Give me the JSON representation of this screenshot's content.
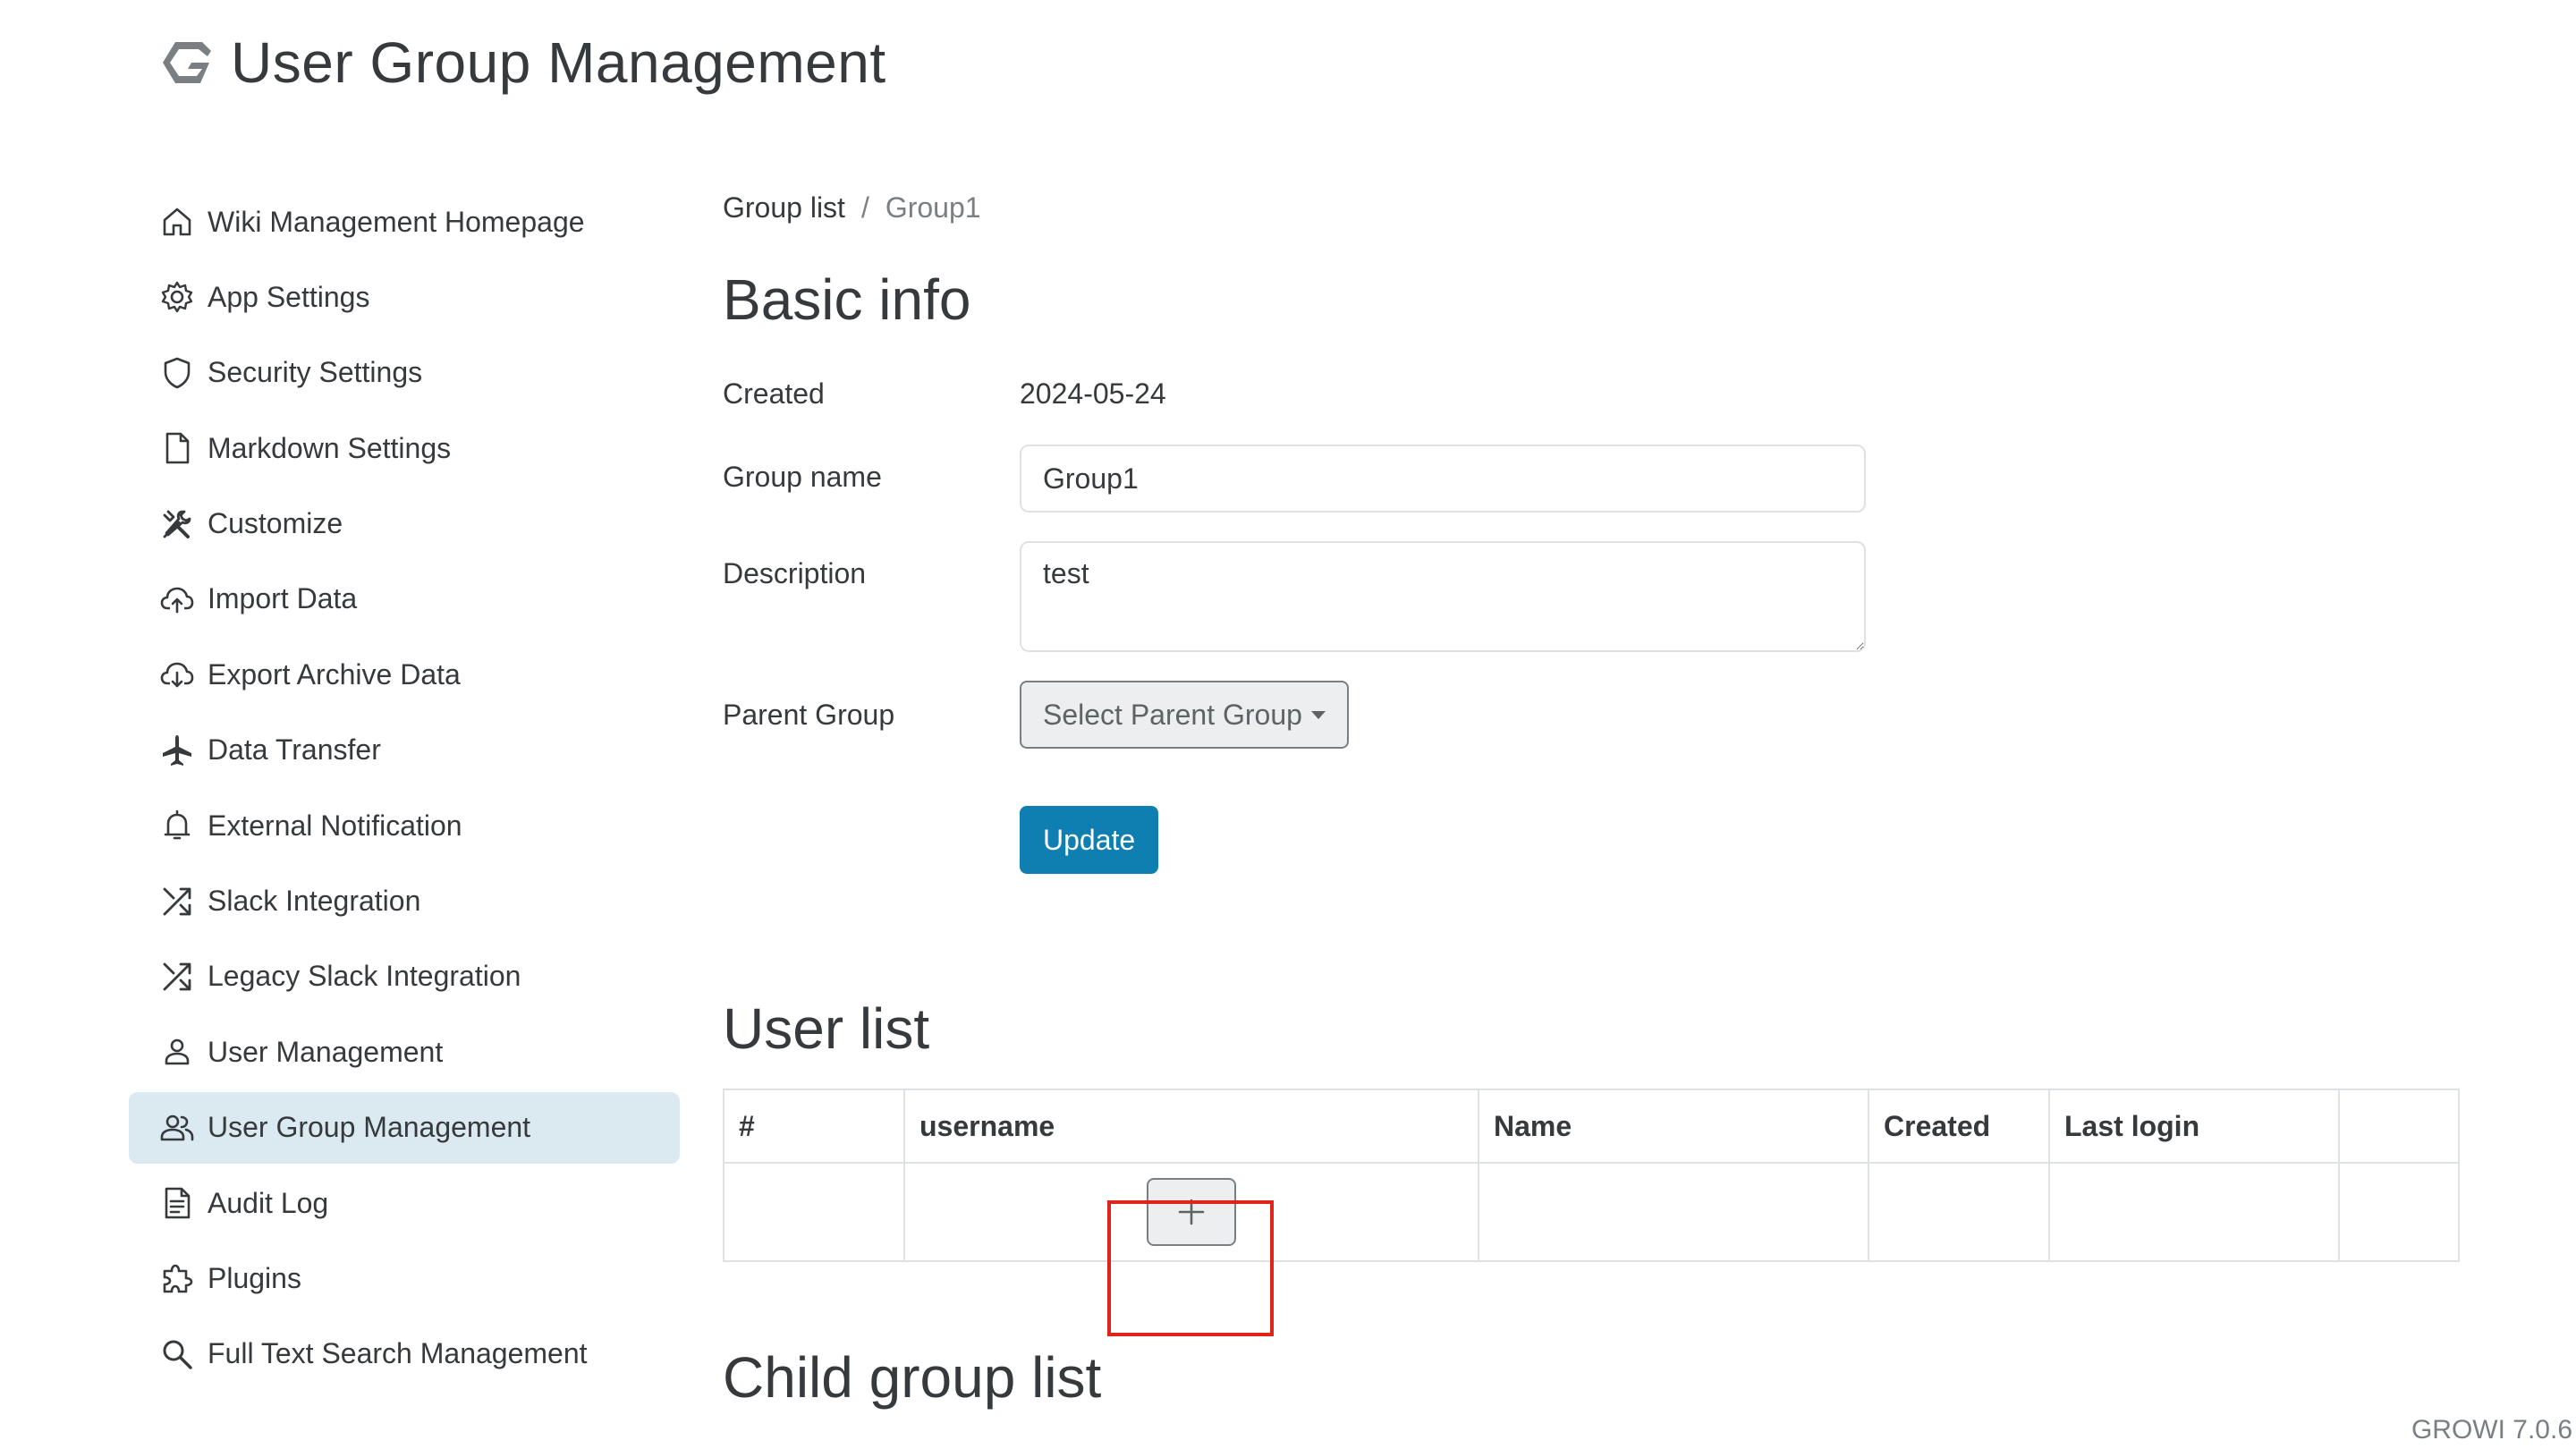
{
  "header": {
    "title": "User Group Management",
    "logo_icon": "growi-logo-icon"
  },
  "sidebar": {
    "items": [
      {
        "label": "Wiki Management Homepage",
        "icon": "home-icon",
        "active": false
      },
      {
        "label": "App Settings",
        "icon": "gear-icon",
        "active": false
      },
      {
        "label": "Security Settings",
        "icon": "shield-icon",
        "active": false
      },
      {
        "label": "Markdown Settings",
        "icon": "file-icon",
        "active": false
      },
      {
        "label": "Customize",
        "icon": "tools-icon",
        "active": false
      },
      {
        "label": "Import Data",
        "icon": "cloud-upload-icon",
        "active": false
      },
      {
        "label": "Export Archive Data",
        "icon": "cloud-download-icon",
        "active": false
      },
      {
        "label": "Data Transfer",
        "icon": "airplane-icon",
        "active": false
      },
      {
        "label": "External Notification",
        "icon": "bell-icon",
        "active": false
      },
      {
        "label": "Slack Integration",
        "icon": "shuffle-icon",
        "active": false
      },
      {
        "label": "Legacy Slack Integration",
        "icon": "shuffle-icon",
        "active": false
      },
      {
        "label": "User Management",
        "icon": "person-icon",
        "active": false
      },
      {
        "label": "User Group Management",
        "icon": "group-icon",
        "active": true
      },
      {
        "label": "Audit Log",
        "icon": "document-icon",
        "active": false
      },
      {
        "label": "Plugins",
        "icon": "puzzle-icon",
        "active": false
      },
      {
        "label": "Full Text Search Management",
        "icon": "search-icon",
        "active": false
      }
    ]
  },
  "breadcrumb": {
    "link": "Group list",
    "separator": "/",
    "current": "Group1"
  },
  "basic_info": {
    "title": "Basic info",
    "created_label": "Created",
    "created_value": "2024-05-24",
    "group_name_label": "Group name",
    "group_name_value": "Group1",
    "description_label": "Description",
    "description_value": "test",
    "parent_group_label": "Parent Group",
    "parent_group_button": "Select Parent Group",
    "update_button": "Update"
  },
  "user_list": {
    "title": "User list",
    "columns": [
      "#",
      "username",
      "Name",
      "Created",
      "Last login",
      ""
    ],
    "add_button_icon": "plus-icon"
  },
  "child_group_list": {
    "title": "Child group list"
  },
  "footer": {
    "version": "GROWI 7.0.6"
  },
  "colors": {
    "primary": "#0f7fb1",
    "active_nav_bg": "#dbe9f1",
    "highlight": "#e2231a"
  }
}
